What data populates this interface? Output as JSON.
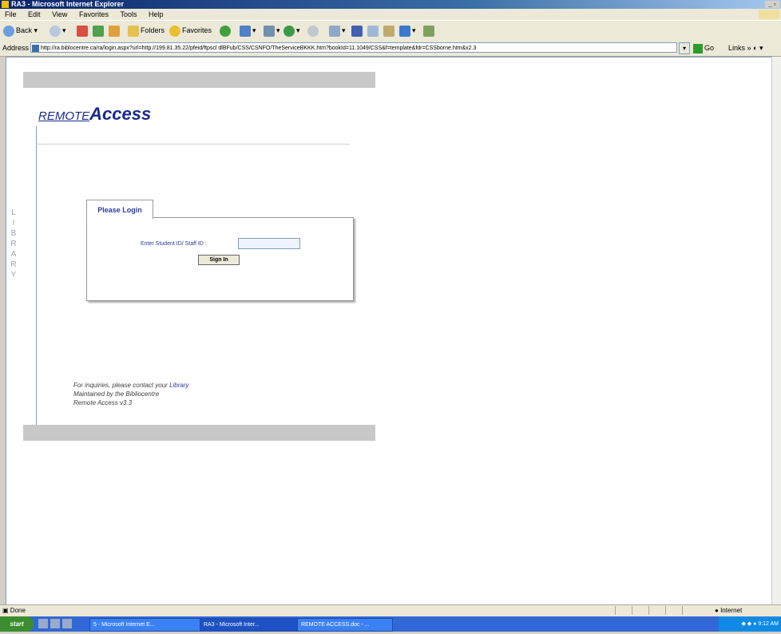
{
  "window": {
    "title": "RA3 - Microsoft Internet Explorer"
  },
  "menu": [
    "File",
    "Edit",
    "View",
    "Favorites",
    "Tools",
    "Help"
  ],
  "toolbar": {
    "back": "Back",
    "folders": "Folders",
    "favorites": "Favorites"
  },
  "address": {
    "label": "Address",
    "url": "http://ra.biblocentre.ca/ra/login.aspx?url=http://199.81.35.22/pfeid/ftpscl dlBFub/CSS/CSNFO/TheServiceBKKK.htm?bookId=11.1049/CSS&f=template&fdr=CSSborne.htm&x2.3",
    "go": "Go",
    "links": "Links"
  },
  "page": {
    "logo_remote": "REMOTE",
    "logo_access": "Access",
    "side_letters": [
      "L",
      "I",
      "B",
      "R",
      "A",
      "R",
      "Y"
    ],
    "login_tab": "Please Login",
    "id_label": "Enter Student ID/ Staff ID :",
    "id_value": "",
    "signin_label": "Sign In",
    "footer_line1": "For inquiries, please contact your ",
    "footer_link": "Library",
    "footer_line2": "Maintained by the Bibliocentre",
    "footer_line3": "Remote Access v3.3"
  },
  "status": {
    "text": "Done",
    "zone": "Internet"
  },
  "taskbar": {
    "start": "start",
    "tasks": [
      "5 - Microsoft Internet E...",
      "RA3 - Microsoft Inter...",
      "REMOTE ACCESS.doc - ..."
    ],
    "clock": "9:12 AM"
  }
}
